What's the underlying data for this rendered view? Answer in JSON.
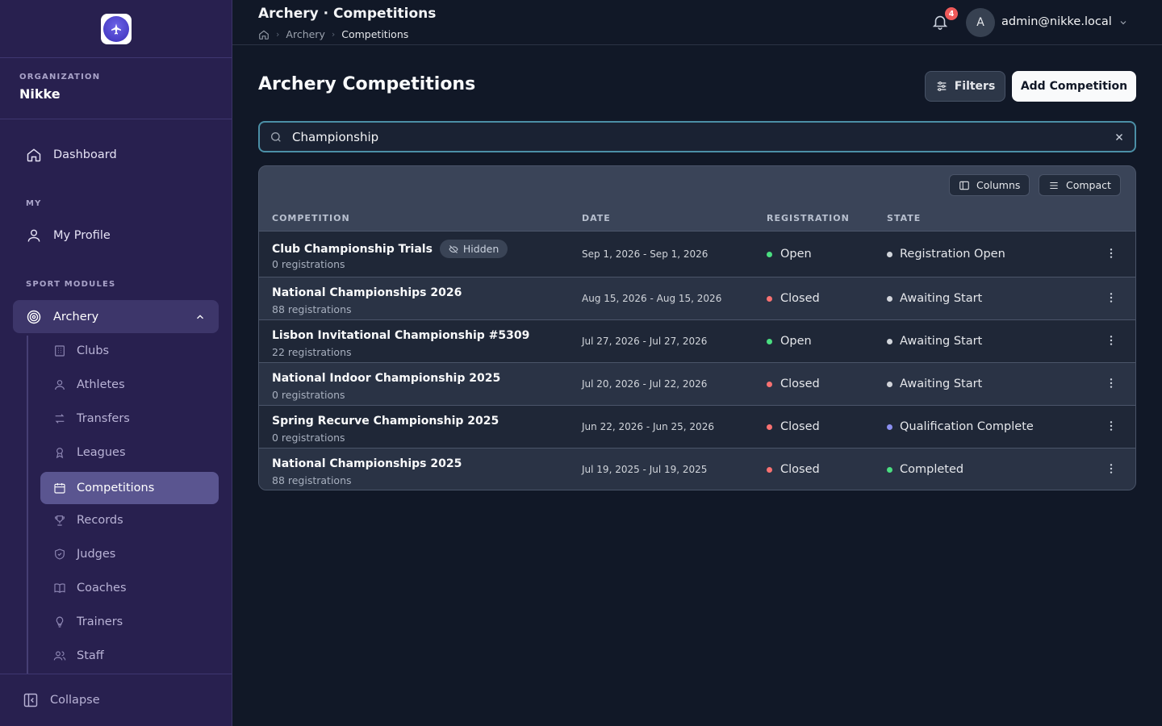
{
  "topbar": {
    "title": "Archery · Competitions",
    "breadcrumb": [
      "Archery",
      "Competitions"
    ],
    "notification_count": "4",
    "avatar_letter": "A",
    "user_email": "admin@nikke.local"
  },
  "sidebar": {
    "org_label": "ORGANIZATION",
    "org_name": "Nikke",
    "dashboard": "Dashboard",
    "my_label": "MY",
    "my_profile": "My Profile",
    "sport_modules_label": "SPORT MODULES",
    "module": "Archery",
    "sub_items": [
      "Clubs",
      "Athletes",
      "Transfers",
      "Leagues",
      "Competitions",
      "Records",
      "Judges",
      "Coaches",
      "Trainers",
      "Staff"
    ],
    "active_item": "Competitions",
    "collapse": "Collapse"
  },
  "main": {
    "title": "Archery Competitions",
    "filters_label": "Filters",
    "add_label": "Add Competition",
    "search_value": "Championship",
    "columns_label": "Columns",
    "compact_label": "Compact",
    "headers": [
      "COMPETITION",
      "DATE",
      "REGISTRATION",
      "STATE"
    ]
  },
  "rows": [
    {
      "name": "Club Championship Trials",
      "hidden_label": "Hidden",
      "registrations": "0 registrations",
      "date": "Sep 1, 2026 - Sep 1, 2026",
      "registration": "Open",
      "state": "Registration Open",
      "state_color": "#d1d5db"
    },
    {
      "name": "National Championships 2026",
      "registrations": "88 registrations",
      "date": "Aug 15, 2026 - Aug 15, 2026",
      "registration": "Closed",
      "state": "Awaiting Start",
      "state_color": "#d1d5db"
    },
    {
      "name": "Lisbon Invitational Championship #5309",
      "registrations": "22 registrations",
      "date": "Jul 27, 2026 - Jul 27, 2026",
      "registration": "Open",
      "state": "Awaiting Start",
      "state_color": "#d1d5db"
    },
    {
      "name": "National Indoor Championship 2025",
      "registrations": "0 registrations",
      "date": "Jul 20, 2026 - Jul 22, 2026",
      "registration": "Closed",
      "state": "Awaiting Start",
      "state_color": "#d1d5db"
    },
    {
      "name": "Spring Recurve Championship 2025",
      "registrations": "0 registrations",
      "date": "Jun 22, 2026 - Jun 25, 2026",
      "registration": "Closed",
      "state": "Qualification Complete",
      "state_color": "#8b8ff0"
    },
    {
      "name": "National Championships 2025",
      "registrations": "88 registrations",
      "date": "Jul 19, 2025 - Jul 19, 2025",
      "registration": "Closed",
      "state": "Completed",
      "state_color": "#4ade80"
    }
  ],
  "colors": {
    "open": "#4ade80",
    "closed": "#f87171",
    "accent": "#4b8fa6",
    "sidebar": "#28204f"
  }
}
